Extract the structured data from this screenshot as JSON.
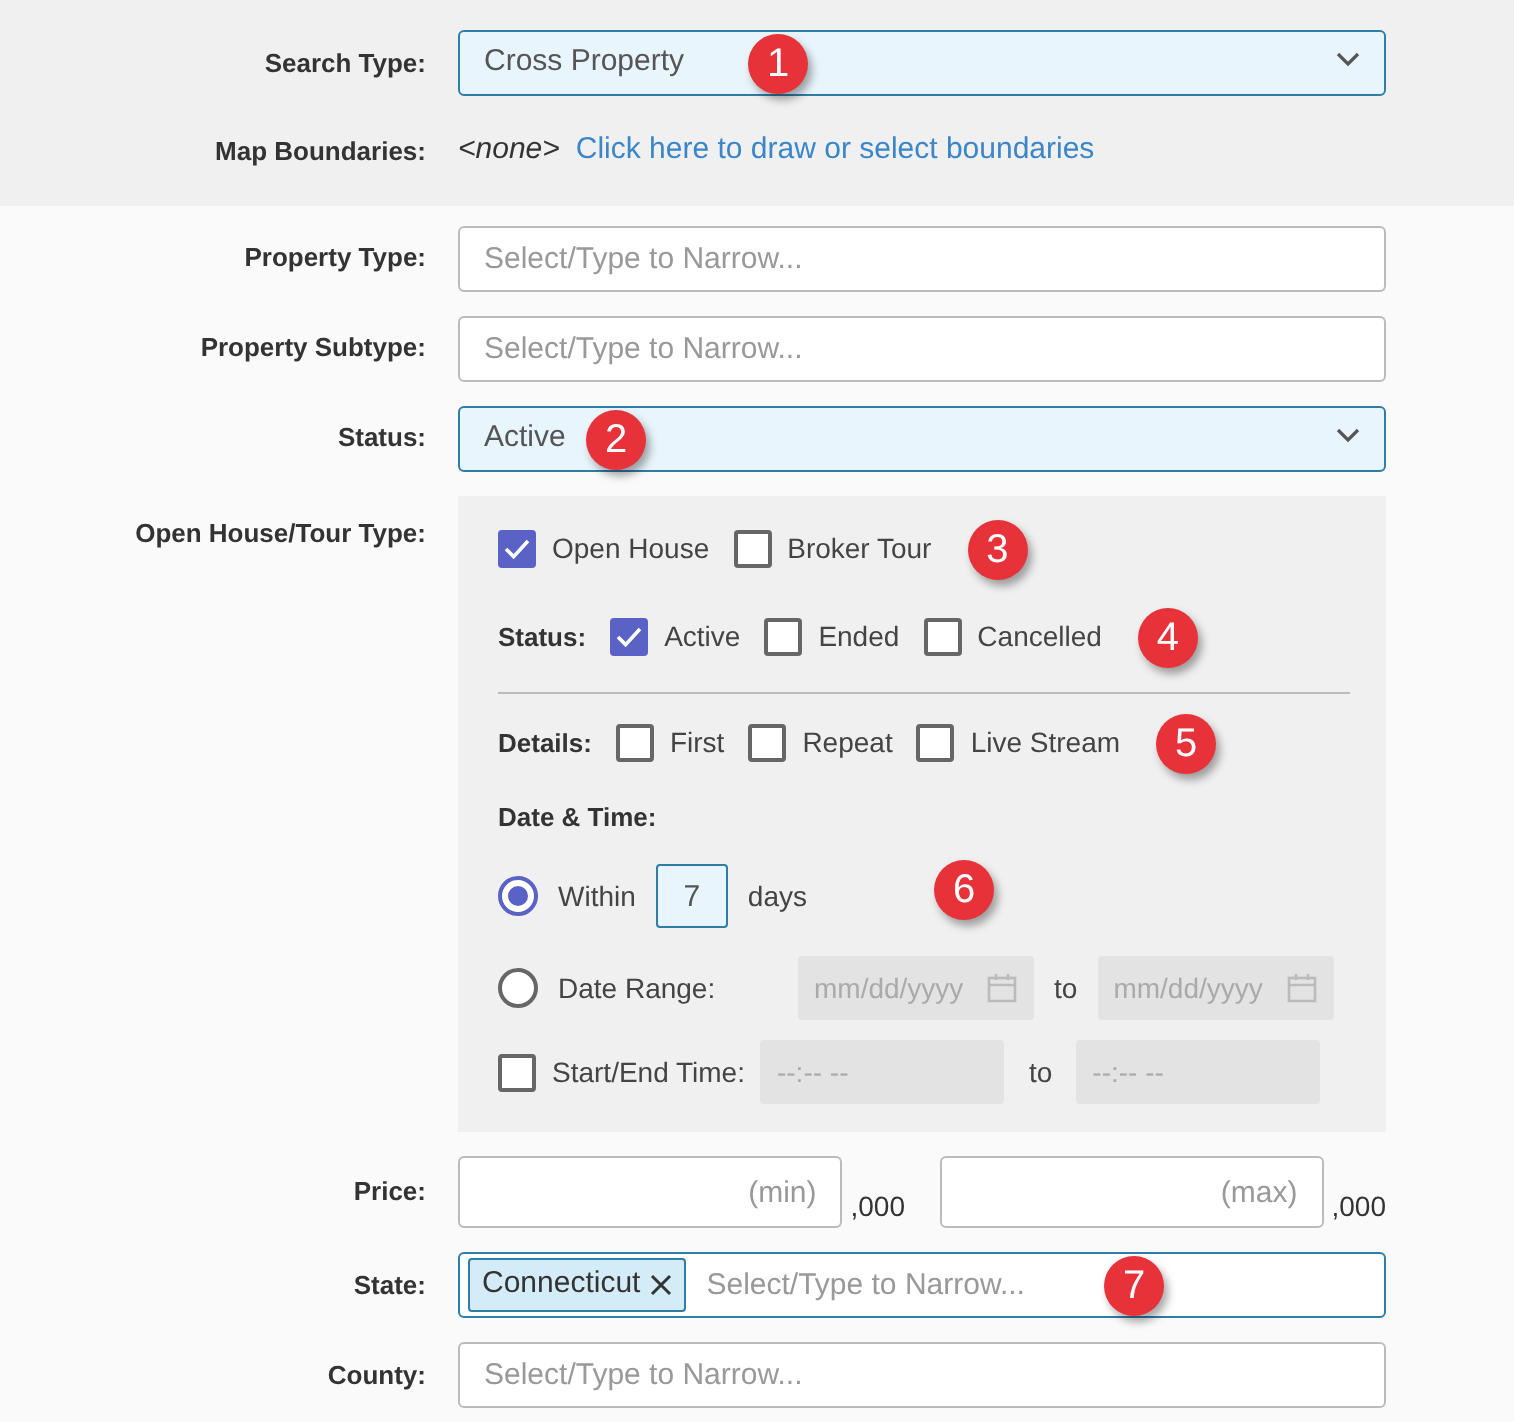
{
  "search_type": {
    "label": "Search Type:",
    "value": "Cross Property",
    "callout": "1"
  },
  "map_boundaries": {
    "label": "Map Boundaries:",
    "value": "<none>",
    "link": "Click here to draw or select boundaries"
  },
  "property_type": {
    "label": "Property Type:",
    "placeholder": "Select/Type to Narrow..."
  },
  "property_subtype": {
    "label": "Property Subtype:",
    "placeholder": "Select/Type to Narrow..."
  },
  "status": {
    "label": "Status:",
    "value": "Active",
    "callout": "2"
  },
  "open_house": {
    "label": "Open House/Tour Type:",
    "types": [
      {
        "label": "Open House",
        "checked": true
      },
      {
        "label": "Broker Tour",
        "checked": false
      }
    ],
    "types_callout": "3",
    "status": {
      "label": "Status:",
      "callout": "4",
      "options": [
        {
          "label": "Active",
          "checked": true
        },
        {
          "label": "Ended",
          "checked": false
        },
        {
          "label": "Cancelled",
          "checked": false
        }
      ]
    },
    "details": {
      "label": "Details:",
      "callout": "5",
      "options": [
        {
          "label": "First",
          "checked": false
        },
        {
          "label": "Repeat",
          "checked": false
        },
        {
          "label": "Live Stream",
          "checked": false
        }
      ]
    },
    "date_time": {
      "label": "Date & Time:",
      "callout": "6",
      "within": {
        "selected": true,
        "label": "Within",
        "value": "7",
        "unit": "days"
      },
      "date_range": {
        "selected": false,
        "label": "Date Range:",
        "from_placeholder": "mm/dd/yyyy",
        "to": "to",
        "to_placeholder": "mm/dd/yyyy"
      },
      "time": {
        "checked": false,
        "label": "Start/End Time:",
        "from_placeholder": "--:-- --",
        "to": "to",
        "to_placeholder": "--:-- --"
      }
    }
  },
  "price": {
    "label": "Price:",
    "min_placeholder": "(min)",
    "min_suffix": ",000",
    "max_placeholder": "(max)",
    "max_suffix": ",000"
  },
  "state": {
    "label": "State:",
    "tags": [
      "Connecticut"
    ],
    "placeholder": "Select/Type to Narrow...",
    "callout": "7"
  },
  "county": {
    "label": "County:",
    "placeholder": "Select/Type to Narrow..."
  }
}
